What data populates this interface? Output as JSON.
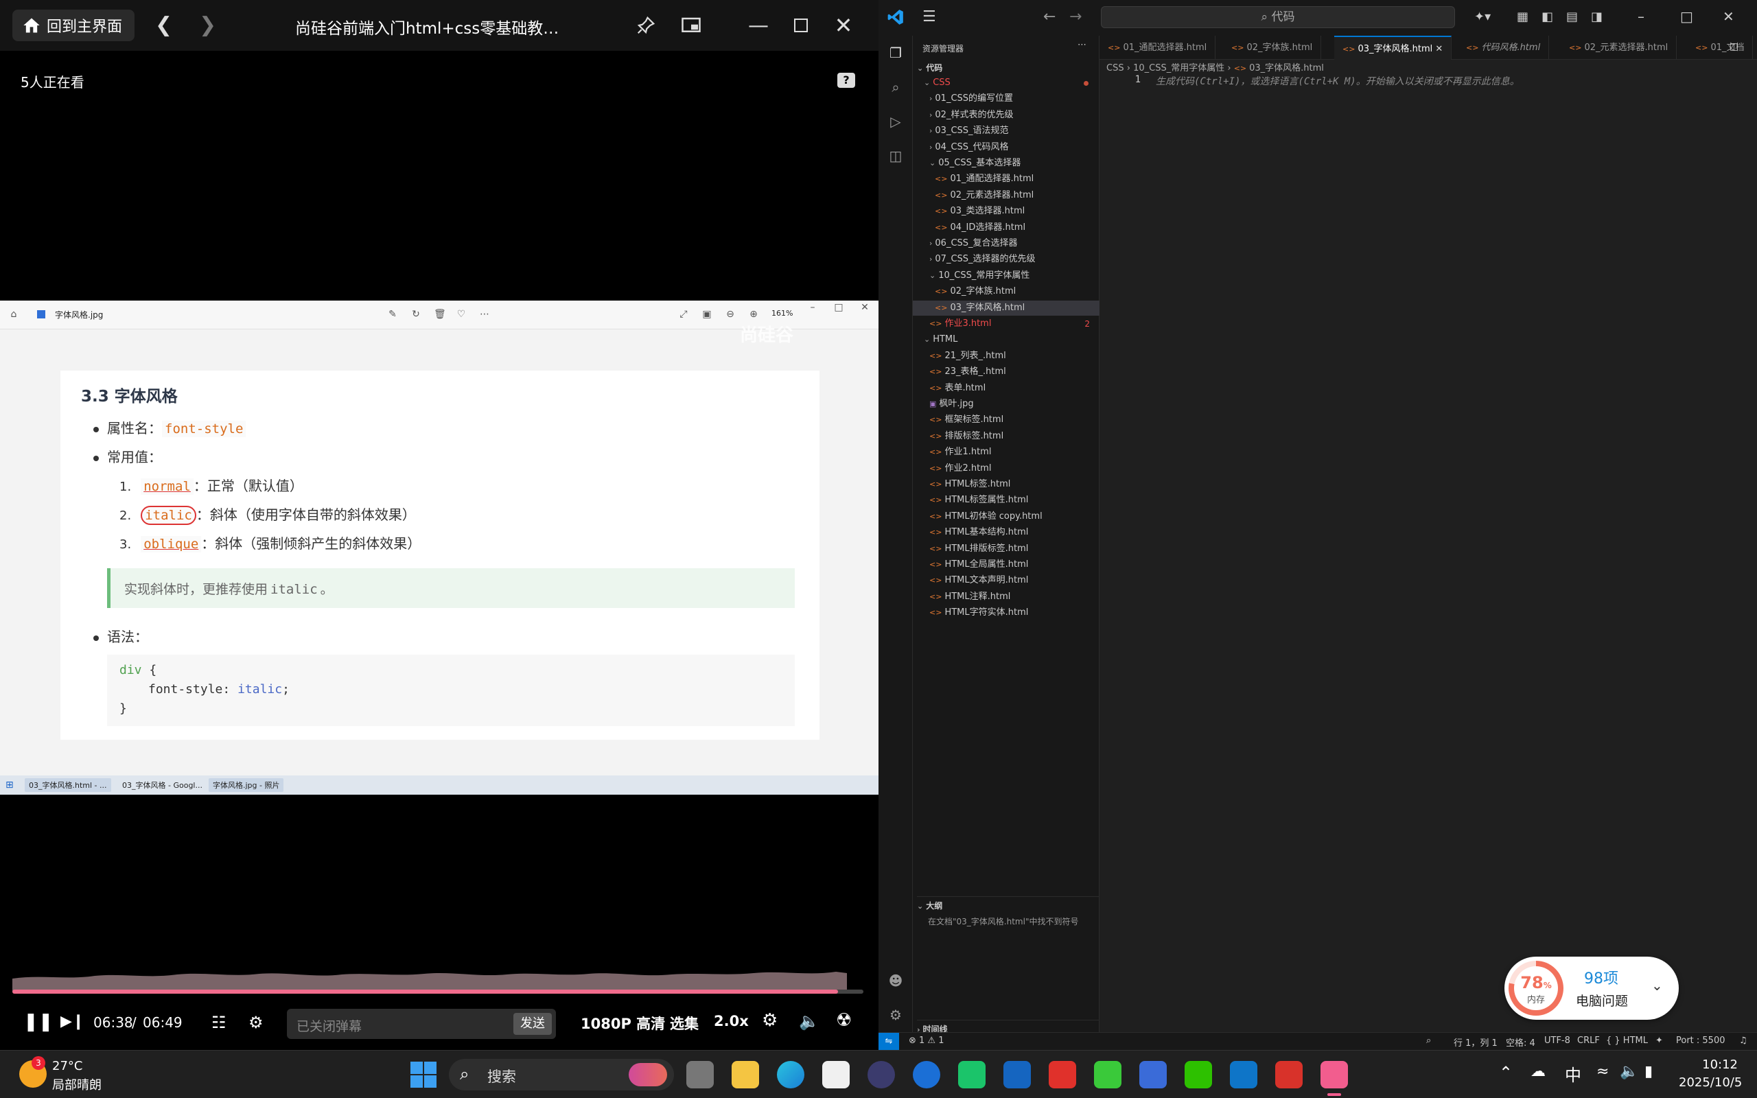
{
  "player": {
    "home_label": "回到主界面",
    "title": "尚硅谷前端入门html+css零基础教…",
    "viewers": "5人正在看",
    "help": "?",
    "current_time": "06:38",
    "time_sep": "/",
    "total_time": "06:49",
    "progress_fraction": 0.97,
    "danmu_placeholder": "已关闭弹幕",
    "send_label": "发送",
    "quality": "1080P 高清",
    "episodes": "选集",
    "speed": "2.0x",
    "watermark": "尚硅谷"
  },
  "viewer": {
    "filename": "字体风格.jpg",
    "zoom": "161%"
  },
  "doc": {
    "heading": "3.3 字体风格",
    "prop_label": "属性名：",
    "prop_value": "font-style",
    "common_label": "常用值：",
    "values": [
      {
        "num": "1.",
        "code": "normal",
        "desc": "：正常（默认值）"
      },
      {
        "num": "2.",
        "code": "italic",
        "desc": "：斜体（使用字体自带的斜体效果）"
      },
      {
        "num": "3.",
        "code": "oblique",
        "desc": "：斜体（强制倾斜产生的斜体效果）"
      }
    ],
    "quote_text": "实现斜体时，更推荐使用",
    "quote_code": "italic",
    "quote_end": "。",
    "syntax_label": "语法：",
    "code_line1_sel": "div",
    "code_line1_brace": " {",
    "code_line2_prop": "font-style",
    "code_line2_colon": ": ",
    "code_line2_val": "italic",
    "code_line2_semi": ";",
    "code_line3": "}"
  },
  "inner_taskbar": {
    "items": [
      "03_字体风格.html - ...",
      "03_字体风格 - Googl...",
      "字体风格.jpg - 照片"
    ]
  },
  "vscode": {
    "search": "代码",
    "explorer_title": "资源管理器",
    "root_folder": "代码",
    "tree": [
      {
        "label": "CSS",
        "kind": "folder-open",
        "indent": 1,
        "color": "#f14c4c"
      },
      {
        "label": "01_CSS的编写位置",
        "kind": "folder",
        "indent": 2
      },
      {
        "label": "02_样式表的优先级",
        "kind": "folder",
        "indent": 2
      },
      {
        "label": "03_CSS_语法规范",
        "kind": "folder",
        "indent": 2
      },
      {
        "label": "04_CSS_代码风格",
        "kind": "folder",
        "indent": 2
      },
      {
        "label": "05_CSS_基本选择器",
        "kind": "folder-open",
        "indent": 2
      },
      {
        "label": "01_通配选择器.html",
        "kind": "html",
        "indent": 3
      },
      {
        "label": "02_元素选择器.html",
        "kind": "html",
        "indent": 3
      },
      {
        "label": "03_类选择器.html",
        "kind": "html",
        "indent": 3
      },
      {
        "label": "04_ID选择器.html",
        "kind": "html",
        "indent": 3
      },
      {
        "label": "06_CSS_复合选择器",
        "kind": "folder",
        "indent": 2
      },
      {
        "label": "07_CSS_选择器的优先级",
        "kind": "folder",
        "indent": 2
      },
      {
        "label": "10_CSS_常用字体属性",
        "kind": "folder-open",
        "indent": 2
      },
      {
        "label": "02_字体族.html",
        "kind": "html",
        "indent": 3
      },
      {
        "label": "03_字体风格.html",
        "kind": "html",
        "indent": 3,
        "selected": true
      },
      {
        "label": "作业3.html",
        "kind": "html",
        "indent": 2,
        "color": "#f14c4c",
        "badge": "2"
      },
      {
        "label": "HTML",
        "kind": "folder-open",
        "indent": 1
      },
      {
        "label": "21_列表_.html",
        "kind": "html",
        "indent": 2
      },
      {
        "label": "23_表格_.html",
        "kind": "html",
        "indent": 2
      },
      {
        "label": "表单.html",
        "kind": "html",
        "indent": 2
      },
      {
        "label": "枫叶.jpg",
        "kind": "image",
        "indent": 2
      },
      {
        "label": "框架标签.html",
        "kind": "html",
        "indent": 2
      },
      {
        "label": "排版标签.html",
        "kind": "html",
        "indent": 2
      },
      {
        "label": "作业1.html",
        "kind": "html",
        "indent": 2
      },
      {
        "label": "作业2.html",
        "kind": "html",
        "indent": 2
      },
      {
        "label": "HTML标签.html",
        "kind": "html",
        "indent": 2
      },
      {
        "label": "HTML标签属性.html",
        "kind": "html",
        "indent": 2
      },
      {
        "label": "HTML初体验 copy.html",
        "kind": "html",
        "indent": 2
      },
      {
        "label": "HTML基本结构.html",
        "kind": "html",
        "indent": 2
      },
      {
        "label": "HTML排版标签.html",
        "kind": "html",
        "indent": 2
      },
      {
        "label": "HTML全局属性.html",
        "kind": "html",
        "indent": 2
      },
      {
        "label": "HTML文本声明.html",
        "kind": "html",
        "indent": 2
      },
      {
        "label": "HTML注释.html",
        "kind": "html",
        "indent": 2
      },
      {
        "label": "HTML字符实体.html",
        "kind": "html",
        "indent": 2
      }
    ],
    "outline_title": "大纲",
    "outline_text": "在文档\"03_字体风格.html\"中找不到符号",
    "timeline_title": "时间线",
    "tabs": [
      {
        "label": "01_通配选择器.html"
      },
      {
        "label": "02_字体族.html"
      },
      {
        "label": "03_字体风格.html",
        "active": true
      },
      {
        "label": "代码风格.html"
      },
      {
        "label": "02_元素选择器.html"
      },
      {
        "label": "01_文档"
      }
    ],
    "breadcrumb": [
      "CSS",
      "10_CSS_常用字体属性",
      "03_字体风格.html"
    ],
    "line_number": "1",
    "editor_hint": "生成代码(Ctrl+I)，或选择语言(Ctrl+K M)。开始输入以关闭或不再显示此信息。",
    "status": {
      "errors": "⊗ 1 ⚠ 1",
      "position": "行 1，列 1",
      "spaces": "空格: 4",
      "encoding": "UTF-8",
      "eol": "CRLF",
      "language": "{ } HTML",
      "port": "Port : 5500"
    }
  },
  "perf": {
    "percent": "78",
    "percent_sign": "%",
    "label": "内存",
    "count": "98项",
    "desc": "电脑问题"
  },
  "taskbar": {
    "weather_temp": "27°C",
    "weather_desc": "局部晴朗",
    "weather_badge": "3",
    "search": "搜索",
    "ime": "中",
    "time": "10:12",
    "date": "2025/10/5"
  }
}
